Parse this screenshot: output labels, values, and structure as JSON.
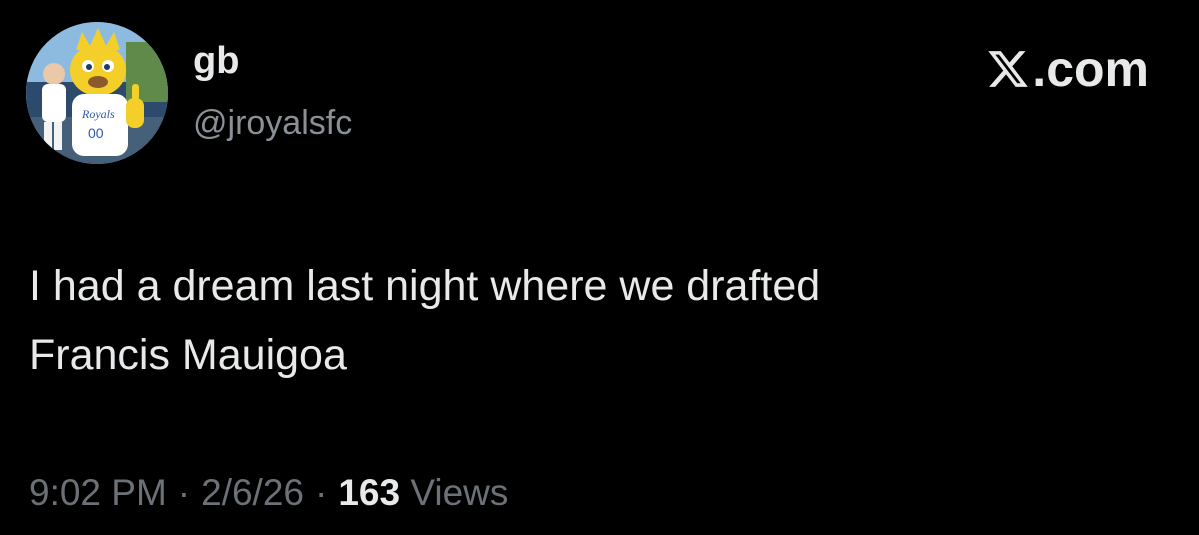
{
  "author": {
    "display_name": "gb",
    "handle": "@jroyalsfc",
    "avatar_icon": "mascot-photo-avatar"
  },
  "brand": {
    "icon": "x-logo-icon",
    "label": ".com"
  },
  "tweet": {
    "lines": [
      "I had a dream last night where we drafted",
      "Francis Mauigoa"
    ]
  },
  "meta": {
    "time": "9:02 PM",
    "date": "2/6/26",
    "separator": "·",
    "views_count": "163",
    "views_label": "Views"
  },
  "colors": {
    "background": "#000000",
    "primary_text": "#e7e9ea",
    "secondary_text": "#8b9096"
  }
}
